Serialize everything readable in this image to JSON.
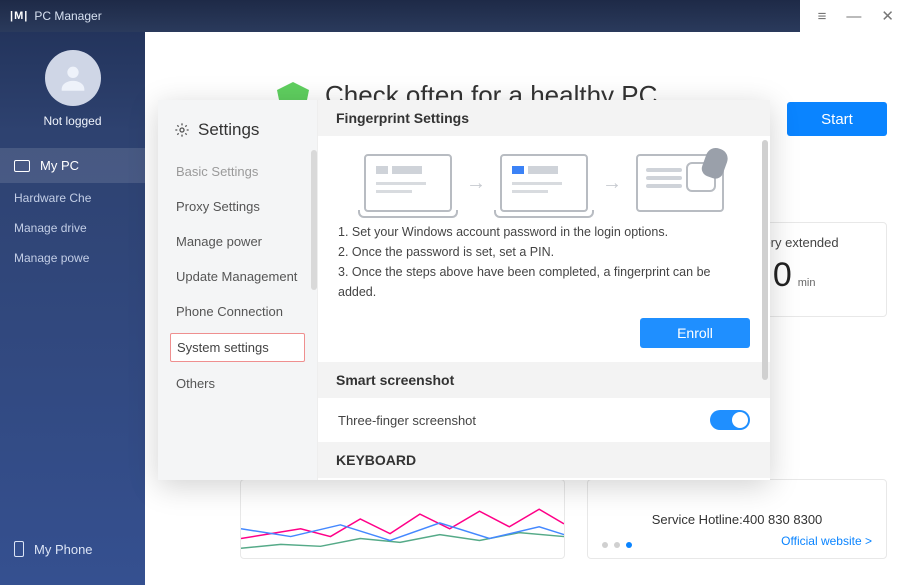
{
  "app": {
    "name": "PC Manager",
    "logo": "|M|"
  },
  "window_controls": {
    "menu": "≡",
    "minimize": "—",
    "close": "✕"
  },
  "sidebar": {
    "login_text": "Not logged",
    "items": [
      {
        "label": "My PC",
        "active": true
      },
      {
        "label": "Hardware Che"
      },
      {
        "label": "Manage drive"
      },
      {
        "label": "Manage powe"
      }
    ],
    "phone": "My Phone"
  },
  "hero": {
    "title": "Check often for a healthy PC",
    "start": "Start"
  },
  "battery": {
    "label": "attery extended",
    "value": "0",
    "unit": "min"
  },
  "footer": {
    "hotline": "Service Hotline:400 830 8300",
    "site": "Official website >"
  },
  "settings": {
    "title": "Settings",
    "nav": [
      "Basic Settings",
      "Proxy Settings",
      "Manage power",
      "Update Management",
      "Phone Connection",
      "System settings",
      "Others"
    ],
    "fingerprint": {
      "heading": "Fingerprint Settings",
      "step1": "1. Set your Windows account password in the login options.",
      "step2": "2. Once the password is set, set a PIN.",
      "step3": "3. Once the steps above have been completed, a fingerprint can be added.",
      "enroll": "Enroll"
    },
    "smart": {
      "heading": "Smart screenshot",
      "row": "Three-finger screenshot"
    },
    "keyboard": {
      "heading": "KEYBOARD"
    }
  }
}
